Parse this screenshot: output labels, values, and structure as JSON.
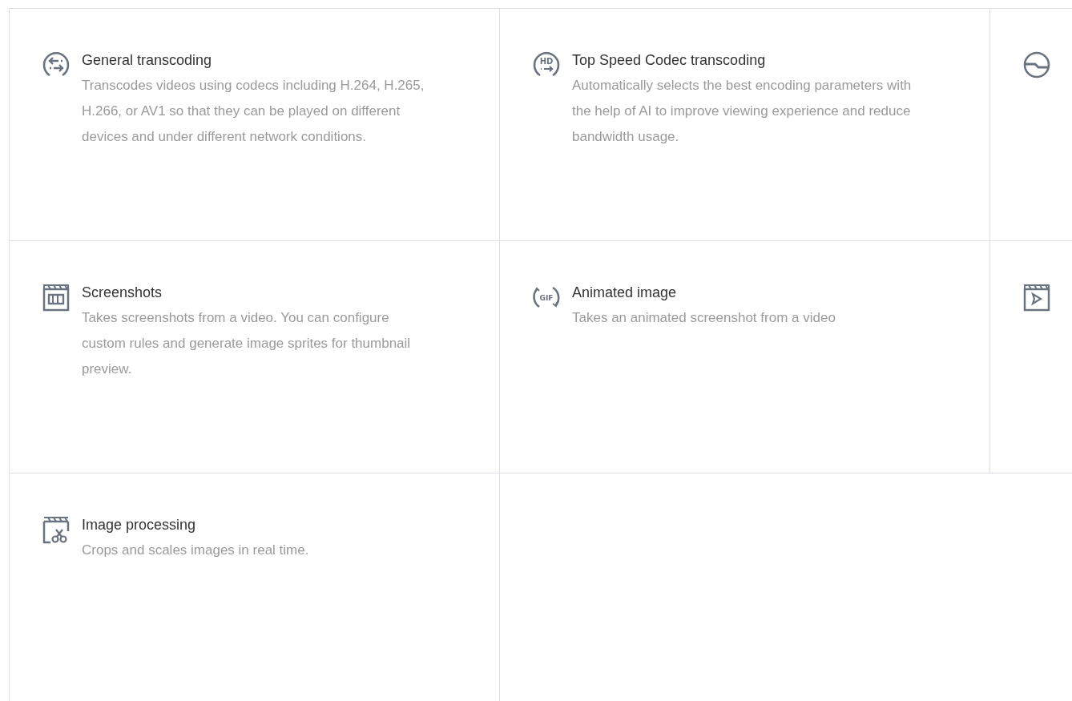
{
  "cards": [
    {
      "kind": "transcode",
      "title": "General transcoding",
      "description": "Transcodes videos using codecs including H.264, H.265, H.266, or AV1 so that they can be played on different devices and under different network conditions."
    },
    {
      "kind": "hd",
      "icon_text": "HD",
      "title": "Top Speed Codec transcoding",
      "description": "Automatically selects the best encoding parameters with the help of AI to improve viewing experience and reduce bandwidth usage."
    },
    {
      "kind": "enhance"
    },
    {
      "kind": "clapper",
      "title": "Screenshots",
      "description": "Takes screenshots from a video. You can configure custom rules and generate image sprites for thumbnail preview."
    },
    {
      "kind": "gif",
      "icon_text": "GIF",
      "title": "Animated image",
      "description": "Takes an animated screenshot from a video"
    },
    {
      "kind": "play_clapper"
    },
    {
      "kind": "scissors_clapper",
      "title": "Image processing",
      "description": "Crops and scales images in real time."
    }
  ]
}
